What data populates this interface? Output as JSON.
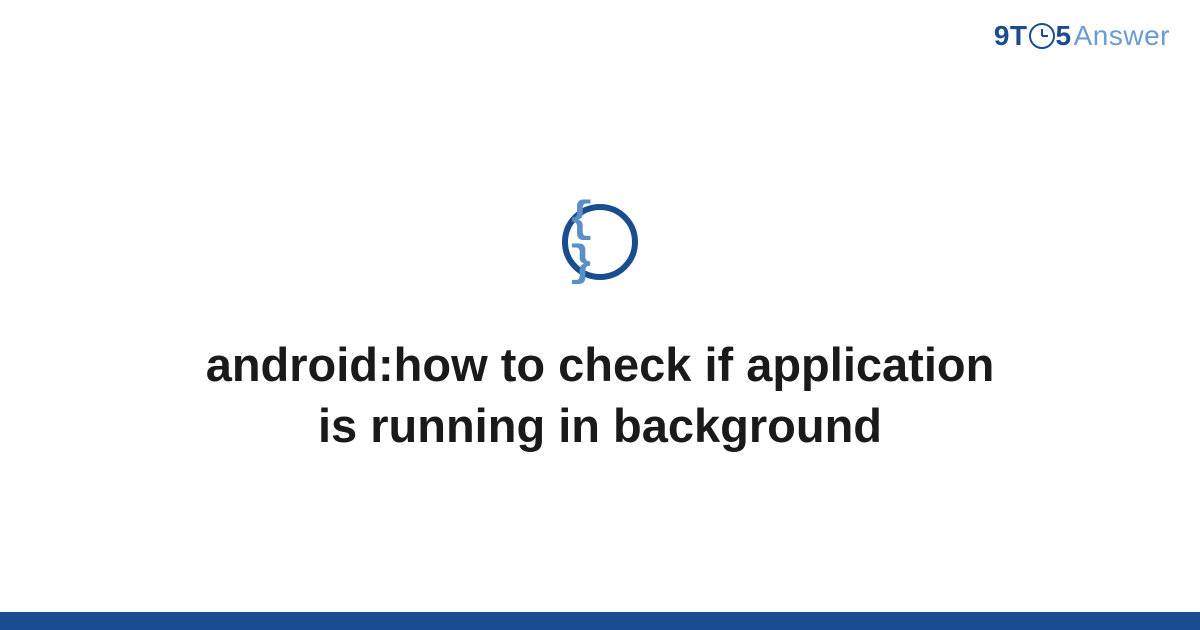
{
  "logo": {
    "part1": "9T",
    "part2": "5",
    "part3": "Answer"
  },
  "icon": {
    "glyph": "{ }",
    "name": "code-braces-icon"
  },
  "title": "android:how to check if application is running in background",
  "colors": {
    "brand_dark": "#1a4d8f",
    "brand_light": "#6b9bd1",
    "text": "#1a1a1a"
  }
}
